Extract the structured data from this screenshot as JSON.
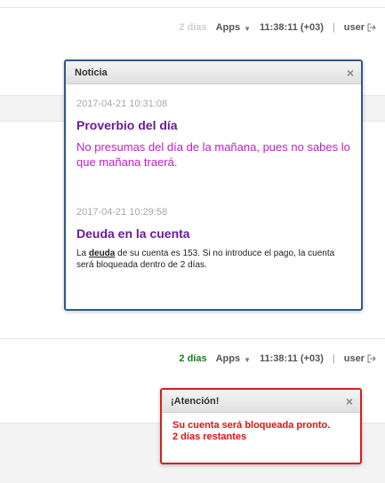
{
  "header1": {
    "faded_text_1": "2 días",
    "faded_text_2": "",
    "apps_label": "Apps",
    "clock": "11:38:11 (+03)",
    "separator": "|",
    "user_label": "user"
  },
  "notice_modal": {
    "title": "Noticia",
    "close_symbol": "×",
    "entries": [
      {
        "timestamp": "2017-04-21 10:31:08",
        "title": "Proverbio del día",
        "text": "No presumas del día de la mañana, pues no sabes lo que mañana traerá."
      },
      {
        "timestamp": "2017-04-21 10:29:58",
        "title": "Deuda en la cuenta",
        "text_before": "La ",
        "link_text": "deuda",
        "text_after": " de su cuenta es 153. Si no introduce el pago, la cuenta será bloqueada dentro de 2 días."
      }
    ]
  },
  "header2": {
    "days_left": "2 días",
    "apps_label": "Apps",
    "clock": "11:38:11 (+03)",
    "separator": "|",
    "user_label": "user"
  },
  "alert_modal": {
    "title": "¡Atención!",
    "close_symbol": "×",
    "line1": "Su cuenta será bloqueada pronto.",
    "line2": "2 días restantes"
  },
  "colors": {
    "notice_border": "#2c5b86",
    "alert_border": "#d42020",
    "proverb_title": "#6a1b9a",
    "proverb_text": "#c020c0",
    "alert_text": "#e01010",
    "days_left": "#1a7f1a"
  }
}
